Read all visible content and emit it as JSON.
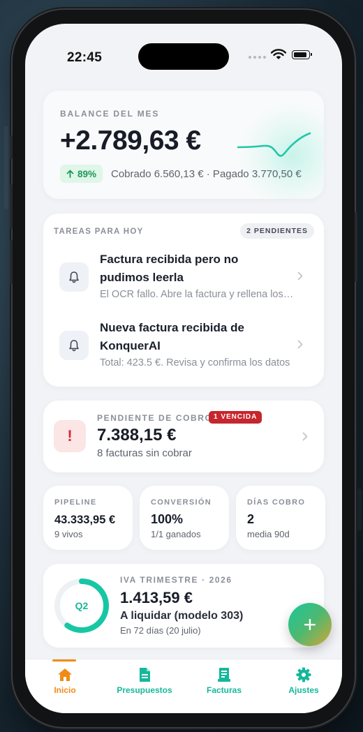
{
  "status_bar": {
    "time": "22:45"
  },
  "balance": {
    "eyebrow": "BALANCE DEL MES",
    "amount": "+2.789,63 €",
    "change_pct": "89%",
    "detail": "Cobrado 6.560,13 € · Pagado 3.770,50 €",
    "accent_color": "#1fc7a6"
  },
  "tasks": {
    "eyebrow": "TAREAS PARA HOY",
    "badge": "2 PENDIENTES",
    "items": [
      {
        "title": "Factura recibida pero no pudimos leerla",
        "subtitle": "El OCR fallo. Abre la factura y rellena los datos"
      },
      {
        "title": "Nueva factura recibida de KonquerAI",
        "subtitle": "Total: 423.5 €. Revisa y confirma los datos"
      }
    ]
  },
  "cobro": {
    "eyebrow": "PENDIENTE DE COBRO",
    "badge": "1 VENCIDA",
    "amount": "7.388,15 €",
    "subtitle": "8 facturas sin cobrar",
    "alert_glyph": "!"
  },
  "stats": [
    {
      "label": "PIPELINE",
      "value": "43.333,95 €",
      "sub": "9 vivos"
    },
    {
      "label": "CONVERSIÓN",
      "value": "100%",
      "sub": "1/1 ganados"
    },
    {
      "label": "DÍAS COBRO",
      "value": "2",
      "sub": "media 90d"
    }
  ],
  "iva": {
    "quarter": "Q2",
    "progress": 0.6,
    "eyebrow": "IVA TRIMESTRE · 2026",
    "amount": "1.413,59 €",
    "subtitle": "A liquidar (modelo 303)",
    "date": "En 72 días (20 julio)"
  },
  "fab": {
    "glyph": "+"
  },
  "tabbar": {
    "items": [
      {
        "label": "Inicio",
        "icon": "home-icon",
        "color": "#f08c16",
        "active": true
      },
      {
        "label": "Presupuestos",
        "icon": "document-icon",
        "color": "#14b89a"
      },
      {
        "label": "Facturas",
        "icon": "receipt-icon",
        "color": "#14b89a"
      },
      {
        "label": "Ajustes",
        "icon": "gear-icon",
        "color": "#14b89a"
      }
    ]
  }
}
